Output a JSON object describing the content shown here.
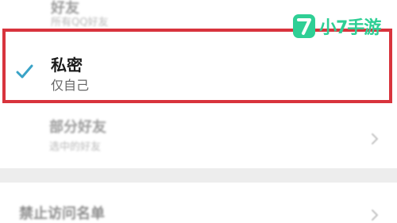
{
  "options": [
    {
      "title": "好友",
      "subtitle": "所有QQ好友",
      "selected": false
    },
    {
      "title": "私密",
      "subtitle": "仅自己",
      "selected": true
    },
    {
      "title": "部分好友",
      "subtitle": "选中的好友",
      "selected": false
    }
  ],
  "block_list": {
    "label": "禁止访问名单"
  },
  "watermark": {
    "badge_glyph": "7",
    "text": "小7手游"
  },
  "colors": {
    "accent": "#3aa3c7",
    "highlight": "#d8343d",
    "watermark": "#2fcf95"
  },
  "icons": {
    "check": "check-icon",
    "chevron": "chevron-right-icon"
  }
}
